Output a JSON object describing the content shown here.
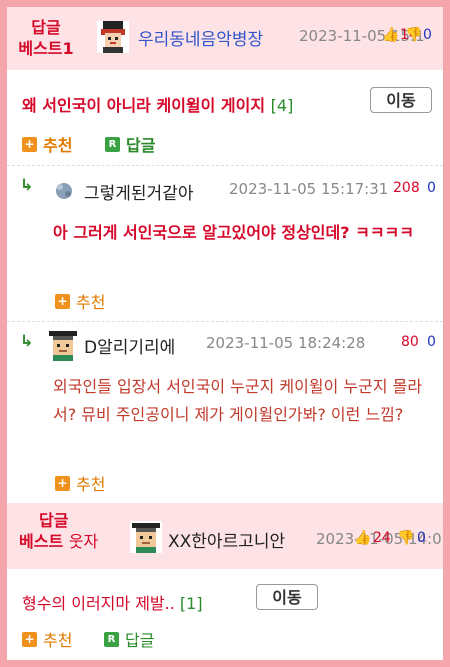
{
  "best1": {
    "tag_line1": "답글",
    "tag_line2": "베스트1",
    "nick": "우리동네음악병장",
    "datetime": "2023-11-05 15:1",
    "thumb_up": "👍",
    "up": "14",
    "thumb_down": "👎",
    "down": "0",
    "title": "왜 서인국이 아니라 케이윌이 게이지",
    "comment_count": "[4]",
    "move_label": "이동",
    "recommend_label": "추천",
    "reply_label": "답글"
  },
  "replies": [
    {
      "nick": "그렇게된거같아",
      "datetime": "2023-11-05 15:17:31",
      "up": "208",
      "down": "0",
      "body": "아 그러게 서인국으로 알고있어야 정상인데? ㅋㅋㅋㅋ",
      "recommend_label": "추천"
    },
    {
      "nick": "D알리기리에",
      "datetime": "2023-11-05 18:24:28",
      "up": "80",
      "down": "0",
      "body": "외국인들 입장서 서인국이 누군지 케이윌이 누군지 몰라서? 뮤비 주인공이니 제가 게이윌인가봐? 이런 느낌?",
      "recommend_label": "추천"
    }
  ],
  "best2": {
    "tag_line1": "답글",
    "tag_line2": "베스트",
    "tag_suffix": "웃자",
    "nick": "XX한아르고니안",
    "datetime": "2023-11-05 14:0",
    "up": "24",
    "down": "0",
    "title": "형수의 이러지마 제발..",
    "comment_count": "[1]",
    "move_label": "이동",
    "recommend_label": "추천",
    "reply_label": "답글"
  },
  "colors": {
    "border_pink": "#f4a6ac",
    "header_pink": "#fde3e5",
    "red": "#d6082a",
    "blue": "#2233bb",
    "green": "#2a8a2a",
    "orange": "#f0911e"
  },
  "icons": [
    "reply-arrow-icon",
    "thumbs-up-icon",
    "thumbs-down-icon",
    "plus-square-icon",
    "reply-square-icon",
    "avatar"
  ]
}
